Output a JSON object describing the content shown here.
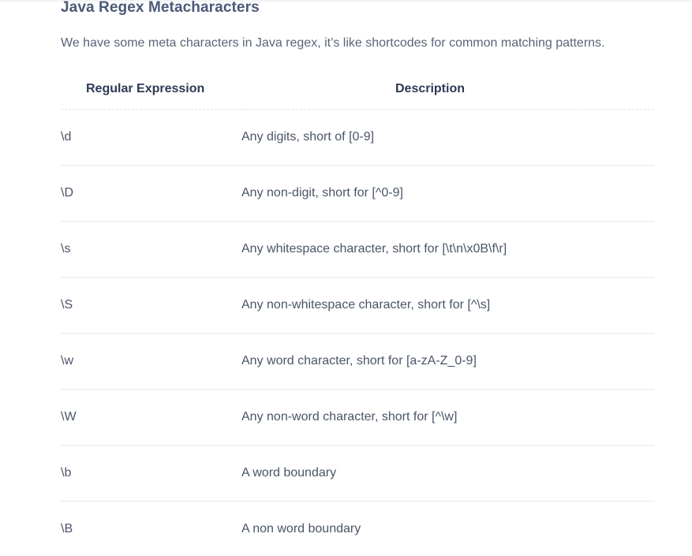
{
  "page": {
    "title": "Java Regex Metacharacters",
    "intro": "We have some meta characters in Java regex, it’s like shortcodes for common matching patterns."
  },
  "table": {
    "headers": {
      "expression": "Regular Expression",
      "description": "Description"
    },
    "rows": [
      {
        "expression": "\\d",
        "description": "Any digits, short of [0-9]"
      },
      {
        "expression": "\\D",
        "description": "Any non-digit, short for [^0-9]"
      },
      {
        "expression": "\\s",
        "description": "Any whitespace character, short for [\\t\\n\\x0B\\f\\r]"
      },
      {
        "expression": "\\S",
        "description": "Any non-whitespace character, short for [^\\s]"
      },
      {
        "expression": "\\w",
        "description": "Any word character, short for [a-zA-Z_0-9]"
      },
      {
        "expression": "\\W",
        "description": "Any non-word character, short for [^\\w]"
      },
      {
        "expression": "\\b",
        "description": "A word boundary"
      },
      {
        "expression": "\\B",
        "description": "A non word boundary"
      }
    ]
  }
}
